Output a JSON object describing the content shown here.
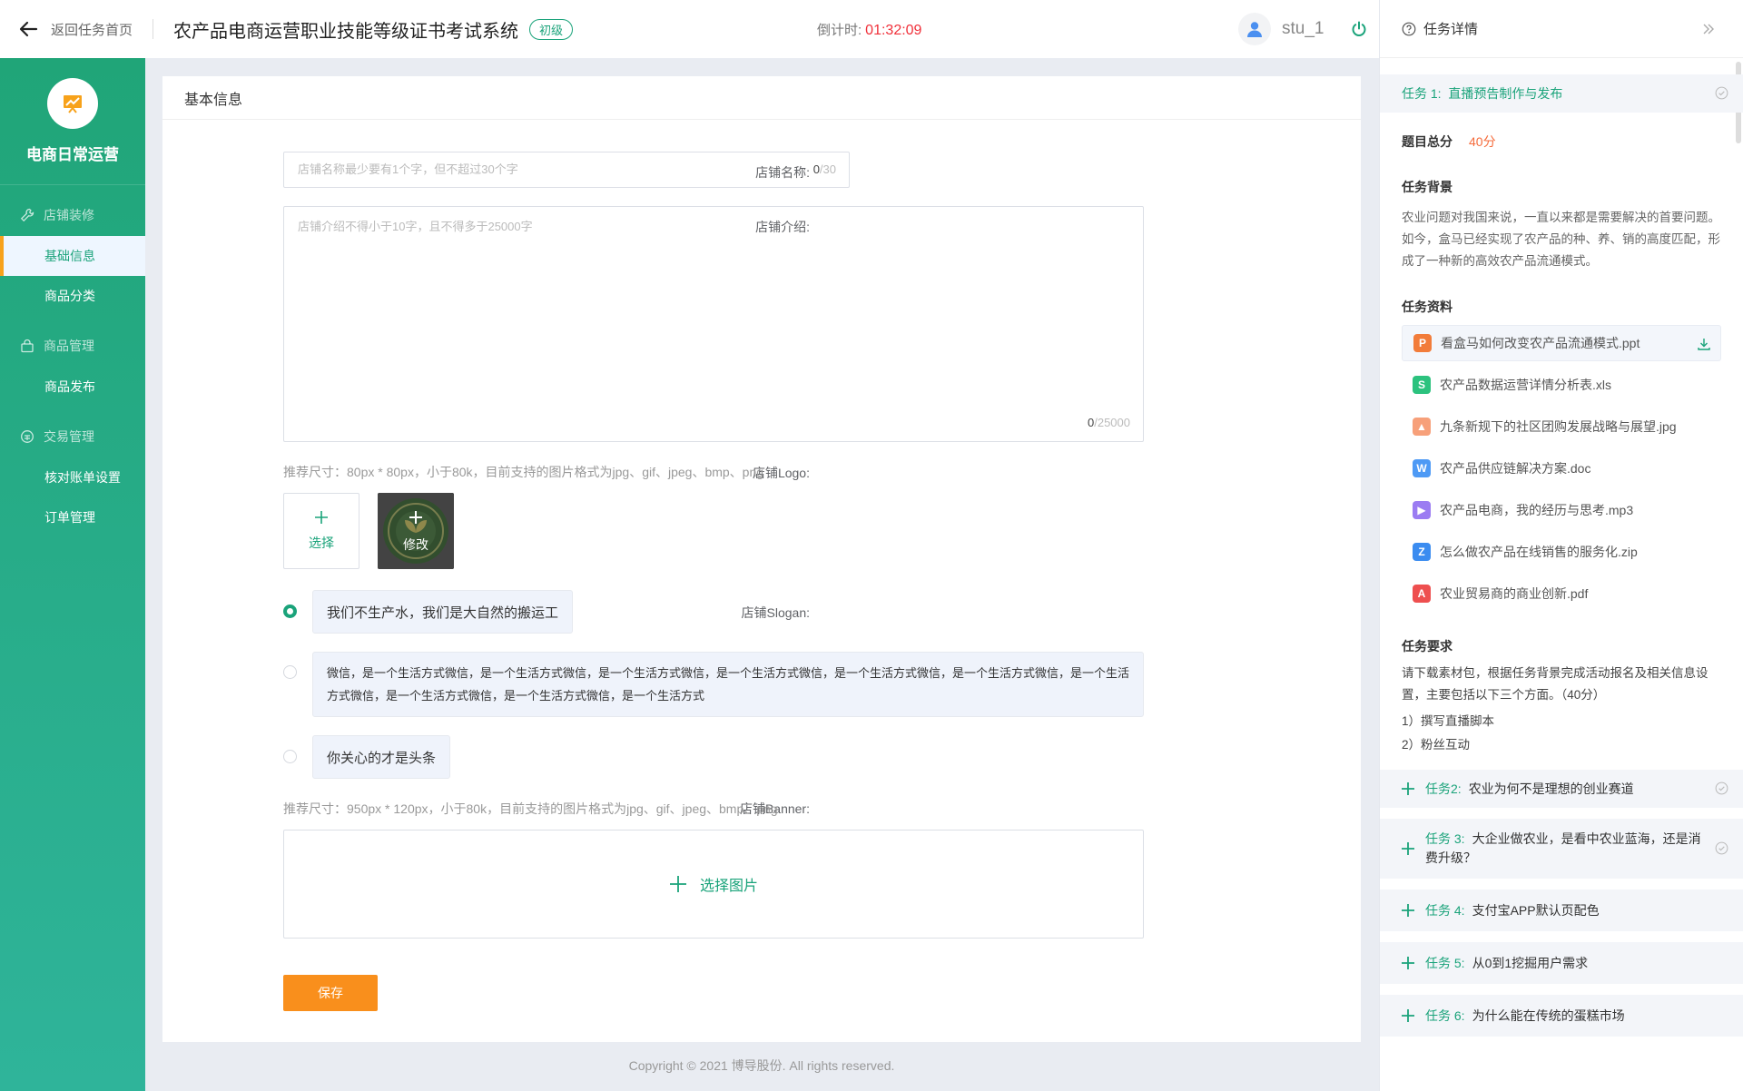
{
  "header": {
    "back_label": "返回任务首页",
    "title": "农产品电商运营职业技能等级证书考试系统",
    "level_badge": "初级",
    "timer_label": "倒计时:",
    "timer_value": "01:32:09",
    "username": "stu_1"
  },
  "sidebar": {
    "brand": "电商日常运营",
    "groups": [
      {
        "label": "店铺装修",
        "icon": "wrench-icon",
        "items": [
          "基础信息",
          "商品分类"
        ]
      },
      {
        "label": "商品管理",
        "icon": "bag-icon",
        "items": [
          "商品发布"
        ]
      },
      {
        "label": "交易管理",
        "icon": "coin-icon",
        "items": [
          "核对账单设置",
          "订单管理"
        ]
      }
    ],
    "active_item": "基础信息"
  },
  "main": {
    "section_title": "基本信息",
    "shop_name": {
      "label": "店铺名称:",
      "placeholder": "店铺名称最少要有1个字，但不超过30个字",
      "count": "0",
      "max": "/30"
    },
    "shop_intro": {
      "label": "店铺介绍:",
      "placeholder": "店铺介绍不得小于10字，且不得多于25000字",
      "count": "0",
      "max": "/25000"
    },
    "logo": {
      "label": "店铺Logo:",
      "hint": "推荐尺寸：80px * 80px，小于80k，目前支持的图片格式为jpg、gif、jpeg、bmp、png",
      "select_label": "选择",
      "modify_label": "修改"
    },
    "slogan": {
      "label": "店铺Slogan:",
      "options": [
        {
          "text": "我们不生产水，我们是大自然的搬运工",
          "selected": true
        },
        {
          "text": "微信，是一个生活方式微信，是一个生活方式微信，是一个生活方式微信，是一个生活方式微信，是一个生活方式微信，是一个生活方式微信，是一个生活方式微信，是一个生活方式微信，是一个生活方式微信，是一个生活方式",
          "selected": false
        },
        {
          "text": "你关心的才是头条",
          "selected": false
        }
      ]
    },
    "banner": {
      "label": "店铺Banner:",
      "hint": "推荐尺寸：950px * 120px，小于80k，目前支持的图片格式为jpg、gif、jpeg、bmp、png",
      "select_label": "选择图片"
    },
    "save_label": "保存"
  },
  "copyright": "Copyright © 2021 博导股份. All rights reserved.",
  "panel": {
    "title": "任务详情",
    "current_task": {
      "num": "任务 1:",
      "title": "直播预告制作与发布"
    },
    "score_label": "题目总分",
    "score_value": "40分",
    "background_title": "任务背景",
    "background_text": "农业问题对我国来说，一直以来都是需要解决的首要问题。如今，盒马已经实现了农产品的种、养、销的高度匹配，形成了一种新的高效农产品流通模式。",
    "materials_title": "任务资料",
    "files": [
      {
        "name": "看盒马如何改变农产品流通模式.ppt",
        "type": "ppt",
        "color": "#f27c3a"
      },
      {
        "name": "农产品数据运营详情分析表.xls",
        "type": "xls",
        "color": "#2cc27e"
      },
      {
        "name": "九条新规下的社区团购发展战略与展望.jpg",
        "type": "jpg",
        "color": "#f7a07a"
      },
      {
        "name": "农产品供应链解决方案.doc",
        "type": "doc",
        "color": "#4e9af5"
      },
      {
        "name": "农产品电商，我的经历与思考.mp3",
        "type": "mp3",
        "color": "#9b7cf2"
      },
      {
        "name": "怎么做农产品在线销售的服务化.zip",
        "type": "zip",
        "color": "#3b8cf0"
      },
      {
        "name": "农业贸易商的商业创新.pdf",
        "type": "pdf",
        "color": "#ee4f4f"
      }
    ],
    "requirements_title": "任务要求",
    "requirements_text": "请下载素材包，根据任务背景完成活动报名及相关信息设置，主要包括以下三个方面。（40分）",
    "requirements_items": [
      "1）撰写直播脚本",
      "2）粉丝互动"
    ],
    "tasks": [
      {
        "num": "任务2:",
        "title": "农业为何不是理想的创业赛道",
        "done": true
      },
      {
        "num": "任务 3:",
        "title": "大企业做农业，是看中农业蓝海，还是消费升级？",
        "done": true
      },
      {
        "num": "任务 4:",
        "title": "支付宝APP默认页配色",
        "done": false
      },
      {
        "num": "任务 5:",
        "title": "从0到1挖掘用户需求",
        "done": false
      },
      {
        "num": "任务 6:",
        "title": "为什么能在传统的蛋糕市场",
        "done": false
      }
    ]
  },
  "colors": {
    "accent": "#1aa37a",
    "orange": "#f98f1c",
    "timer": "#f0303a"
  }
}
